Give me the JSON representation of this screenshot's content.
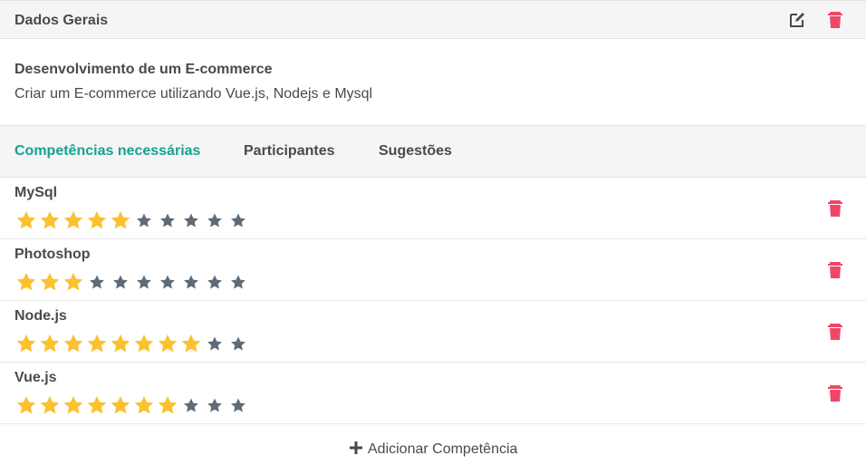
{
  "header": {
    "title": "Dados Gerais",
    "edit_icon": "edit-icon",
    "delete_icon": "trash-icon"
  },
  "project": {
    "title": "Desenvolvimento de um E-commerce",
    "description": "Criar um E-commerce utilizando Vue.js, Nodejs e Mysql"
  },
  "tabs": [
    {
      "label": "Competências necessárias",
      "active": true
    },
    {
      "label": "Participantes",
      "active": false
    },
    {
      "label": "Sugestões",
      "active": false
    }
  ],
  "skills": [
    {
      "name": "MySql",
      "rating": 5,
      "max": 10
    },
    {
      "name": "Photoshop",
      "rating": 3,
      "max": 10
    },
    {
      "name": "Node.js",
      "rating": 8,
      "max": 10
    },
    {
      "name": "Vue.js",
      "rating": 7,
      "max": 10
    }
  ],
  "add_button": {
    "label": "Adicionar Competência",
    "icon": "plus-icon"
  },
  "colors": {
    "accent": "#16a28f",
    "danger": "#f14668",
    "star_filled": "#fbc12e",
    "star_empty": "#5f6b76"
  }
}
